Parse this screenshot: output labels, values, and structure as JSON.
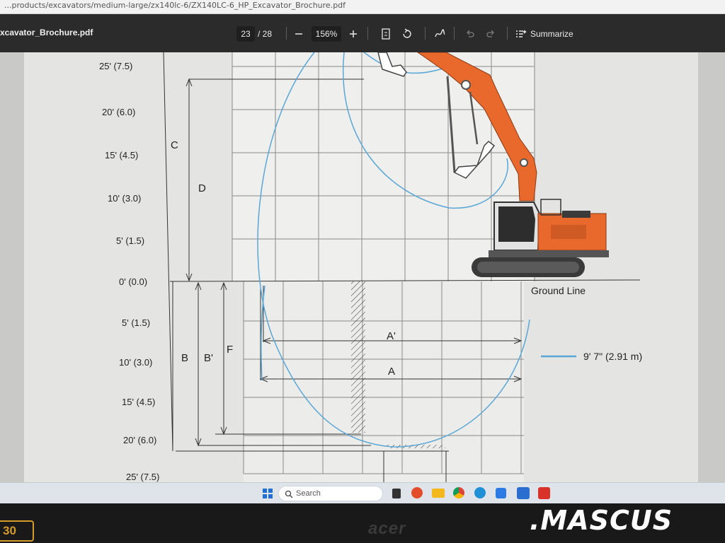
{
  "browser": {
    "url": "...products/excavators/medium-large/zx140lc-6/ZX140LC-6_HP_Excavator_Brochure.pdf"
  },
  "pdf_toolbar": {
    "file_name": "xcavator_Brochure.pdf",
    "current_page": "23",
    "total_pages": "/ 28",
    "zoom": "156%",
    "summarize_label": "Summarize"
  },
  "diagram": {
    "height_labels": [
      "25' (7.5)",
      "20' (6.0)",
      "15' (4.5)",
      "10' (3.0)",
      "5' (1.5)",
      "0' (0.0)",
      "5' (1.5)",
      "10' (3.0)",
      "15' (4.5)",
      "20' (6.0)",
      "25' (7.5)"
    ],
    "dim_letters": {
      "c": "C",
      "d": "D",
      "b": "B",
      "b_prime": "B'",
      "f": "F",
      "a": "A",
      "a_prime": "A'"
    },
    "ground_line_label": "Ground Line",
    "legend_label": "9' 7\" (2.91 m)",
    "line_color": "#5aa7d6",
    "machine_color": "#e8692b"
  },
  "taskbar": {
    "search_placeholder": "Search"
  },
  "bezel": {
    "brand": "acer",
    "watermark": ".MASCUS",
    "badge": "30"
  }
}
